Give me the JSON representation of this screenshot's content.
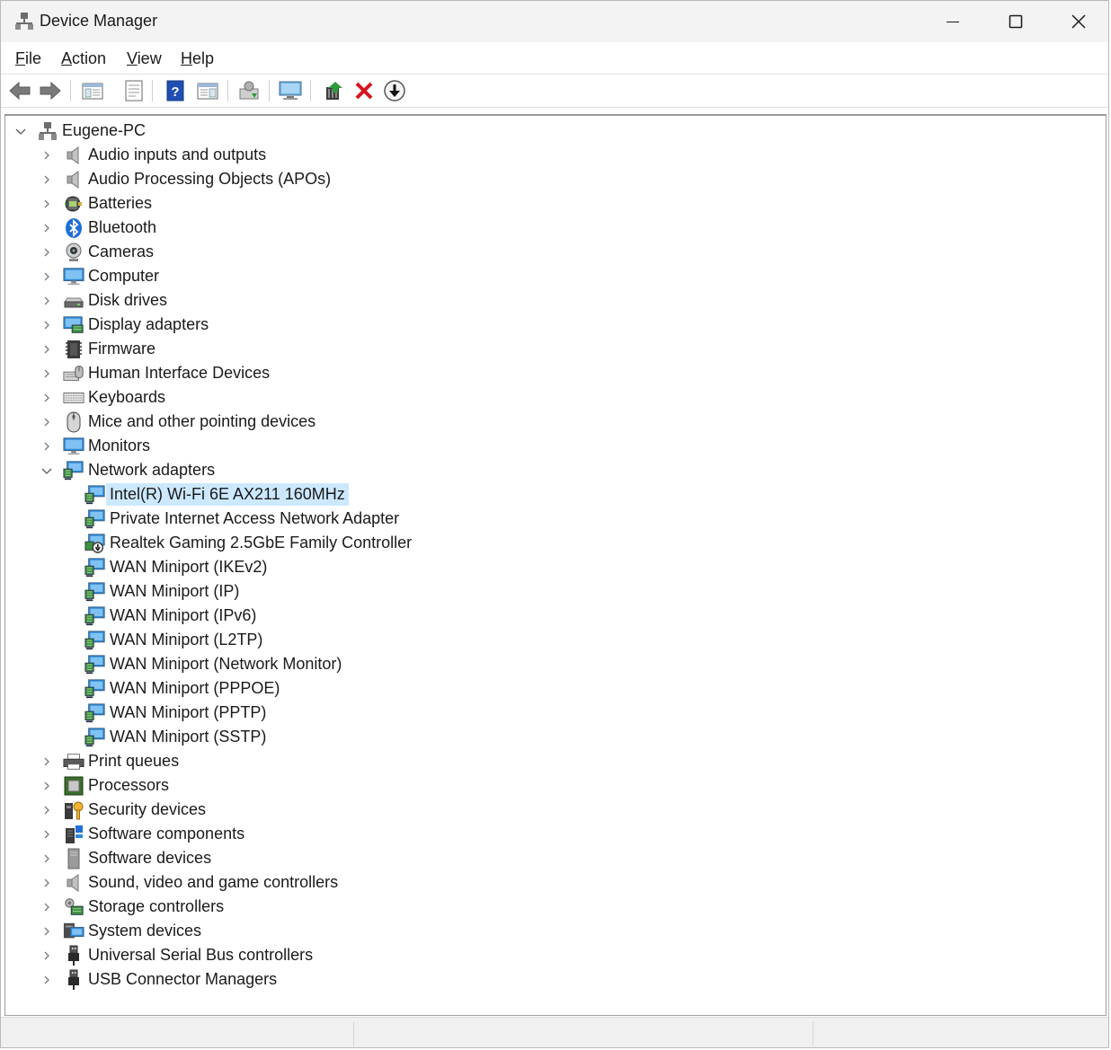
{
  "window": {
    "title": "Device Manager"
  },
  "menu": [
    {
      "label": "File",
      "ul": "F",
      "rest": "ile"
    },
    {
      "label": "Action",
      "ul": "A",
      "rest": "ction"
    },
    {
      "label": "View",
      "ul": "V",
      "rest": "iew"
    },
    {
      "label": "Help",
      "ul": "H",
      "rest": "elp"
    }
  ],
  "toolbar": [
    {
      "name": "back-button",
      "icon": "arrow-left-icon"
    },
    {
      "name": "forward-button",
      "icon": "arrow-right-icon"
    },
    {
      "name": "show-hide-console-tree-button",
      "icon": "console-tree-icon"
    },
    {
      "name": "properties-button",
      "icon": "properties-sheet-icon"
    },
    {
      "name": "help-button",
      "icon": "help-book-icon"
    },
    {
      "name": "action-pane-button",
      "icon": "action-pane-icon"
    },
    {
      "name": "scan-hardware-changes-button",
      "icon": "scan-hardware-icon"
    },
    {
      "name": "monitor-button",
      "icon": "monitor-icon"
    },
    {
      "name": "update-driver-button",
      "icon": "update-driver-icon"
    },
    {
      "name": "uninstall-device-button",
      "icon": "red-x-icon"
    },
    {
      "name": "disable-device-button",
      "icon": "down-arrow-circle-icon"
    }
  ],
  "tree": {
    "root": "Eugene-PC",
    "categories": [
      {
        "label": "Audio inputs and outputs",
        "icon": "speaker-icon",
        "expanded": false
      },
      {
        "label": "Audio Processing Objects (APOs)",
        "icon": "speaker-icon",
        "expanded": false
      },
      {
        "label": "Batteries",
        "icon": "battery-icon",
        "expanded": false
      },
      {
        "label": "Bluetooth",
        "icon": "bluetooth-icon",
        "expanded": false
      },
      {
        "label": "Cameras",
        "icon": "camera-icon",
        "expanded": false
      },
      {
        "label": "Computer",
        "icon": "computer-icon",
        "expanded": false
      },
      {
        "label": "Disk drives",
        "icon": "disk-drive-icon",
        "expanded": false
      },
      {
        "label": "Display adapters",
        "icon": "display-adapter-icon",
        "expanded": false
      },
      {
        "label": "Firmware",
        "icon": "firmware-chip-icon",
        "expanded": false
      },
      {
        "label": "Human Interface Devices",
        "icon": "hid-icon",
        "expanded": false
      },
      {
        "label": "Keyboards",
        "icon": "keyboard-icon",
        "expanded": false
      },
      {
        "label": "Mice and other pointing devices",
        "icon": "mouse-icon",
        "expanded": false
      },
      {
        "label": "Monitors",
        "icon": "monitor-icon",
        "expanded": false
      },
      {
        "label": "Network adapters",
        "icon": "network-adapter-icon",
        "expanded": true,
        "children": [
          {
            "label": "Intel(R) Wi-Fi 6E AX211 160MHz",
            "icon": "network-adapter-icon",
            "selected": true
          },
          {
            "label": "Private Internet Access Network Adapter",
            "icon": "network-adapter-icon"
          },
          {
            "label": "Realtek Gaming 2.5GbE Family Controller",
            "icon": "network-adapter-disabled-icon"
          },
          {
            "label": "WAN Miniport (IKEv2)",
            "icon": "network-adapter-icon"
          },
          {
            "label": "WAN Miniport (IP)",
            "icon": "network-adapter-icon"
          },
          {
            "label": "WAN Miniport (IPv6)",
            "icon": "network-adapter-icon"
          },
          {
            "label": "WAN Miniport (L2TP)",
            "icon": "network-adapter-icon"
          },
          {
            "label": "WAN Miniport (Network Monitor)",
            "icon": "network-adapter-icon"
          },
          {
            "label": "WAN Miniport (PPPOE)",
            "icon": "network-adapter-icon"
          },
          {
            "label": "WAN Miniport (PPTP)",
            "icon": "network-adapter-icon"
          },
          {
            "label": "WAN Miniport (SSTP)",
            "icon": "network-adapter-icon"
          }
        ]
      },
      {
        "label": "Print queues",
        "icon": "printer-icon",
        "expanded": false
      },
      {
        "label": "Processors",
        "icon": "processor-icon",
        "expanded": false
      },
      {
        "label": "Security devices",
        "icon": "security-key-icon",
        "expanded": false
      },
      {
        "label": "Software components",
        "icon": "software-component-icon",
        "expanded": false
      },
      {
        "label": "Software devices",
        "icon": "software-device-icon",
        "expanded": false
      },
      {
        "label": "Sound, video and game controllers",
        "icon": "speaker-icon",
        "expanded": false
      },
      {
        "label": "Storage controllers",
        "icon": "storage-controller-icon",
        "expanded": false
      },
      {
        "label": "System devices",
        "icon": "system-device-icon",
        "expanded": false
      },
      {
        "label": "Universal Serial Bus controllers",
        "icon": "usb-icon",
        "expanded": false
      },
      {
        "label": "USB Connector Managers",
        "icon": "usb-icon",
        "expanded": false
      }
    ]
  },
  "colors": {
    "selection": "#cce8ff",
    "accent": "#0078d4"
  }
}
